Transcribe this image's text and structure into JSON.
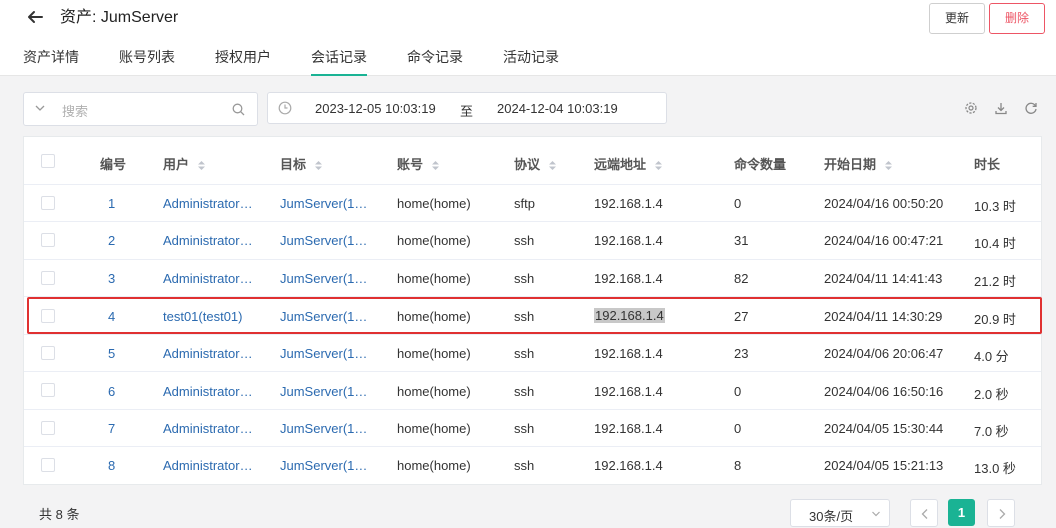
{
  "header": {
    "title": "资产: JumServer",
    "update_label": "更新",
    "delete_label": "删除"
  },
  "tabs": [
    {
      "label": "资产详情"
    },
    {
      "label": "账号列表"
    },
    {
      "label": "授权用户"
    },
    {
      "label": "会话记录",
      "active": true
    },
    {
      "label": "命令记录"
    },
    {
      "label": "活动记录"
    }
  ],
  "search": {
    "placeholder": "搜索"
  },
  "date_range": {
    "start": "2023-12-05 10:03:19",
    "separator": "至",
    "end": "2024-12-04 10:03:19"
  },
  "toolbar": {
    "icons": [
      "settings-icon",
      "download-icon",
      "refresh-icon"
    ]
  },
  "table": {
    "columns": [
      "编号",
      "用户",
      "目标",
      "账号",
      "协议",
      "远端地址",
      "命令数量",
      "开始日期",
      "时长"
    ],
    "rows": [
      {
        "id": "1",
        "user": "Administrator…",
        "target": "JumServer(1…",
        "account": "home(home)",
        "protocol": "sftp",
        "remote": "192.168.1.4",
        "commands": "0",
        "start": "2024/04/16 00:50:20",
        "duration": "10.3 时"
      },
      {
        "id": "2",
        "user": "Administrator…",
        "target": "JumServer(1…",
        "account": "home(home)",
        "protocol": "ssh",
        "remote": "192.168.1.4",
        "commands": "31",
        "start": "2024/04/16 00:47:21",
        "duration": "10.4 时"
      },
      {
        "id": "3",
        "user": "Administrator…",
        "target": "JumServer(1…",
        "account": "home(home)",
        "protocol": "ssh",
        "remote": "192.168.1.4",
        "commands": "82",
        "start": "2024/04/11 14:41:43",
        "duration": "21.2 时"
      },
      {
        "id": "4",
        "user": "test01(test01)",
        "target": "JumServer(1…",
        "account": "home(home)",
        "protocol": "ssh",
        "remote": "192.168.1.4",
        "commands": "27",
        "start": "2024/04/11 14:30:29",
        "duration": "20.9 时"
      },
      {
        "id": "5",
        "user": "Administrator…",
        "target": "JumServer(1…",
        "account": "home(home)",
        "protocol": "ssh",
        "remote": "192.168.1.4",
        "commands": "23",
        "start": "2024/04/06 20:06:47",
        "duration": "4.0 分"
      },
      {
        "id": "6",
        "user": "Administrator…",
        "target": "JumServer(1…",
        "account": "home(home)",
        "protocol": "ssh",
        "remote": "192.168.1.4",
        "commands": "0",
        "start": "2024/04/06 16:50:16",
        "duration": "2.0 秒"
      },
      {
        "id": "7",
        "user": "Administrator…",
        "target": "JumServer(1…",
        "account": "home(home)",
        "protocol": "ssh",
        "remote": "192.168.1.4",
        "commands": "0",
        "start": "2024/04/05 15:30:44",
        "duration": "7.0 秒"
      },
      {
        "id": "8",
        "user": "Administrator…",
        "target": "JumServer(1…",
        "account": "home(home)",
        "protocol": "ssh",
        "remote": "192.168.1.4",
        "commands": "8",
        "start": "2024/04/05 15:21:13",
        "duration": "13.0 秒"
      }
    ]
  },
  "pagination": {
    "total_text": "共 8 条",
    "page_size": "30条/页",
    "current_page": "1"
  },
  "colors": {
    "accent": "#1ab394",
    "danger": "#ed5565",
    "link": "#2b6ab0",
    "selection_frame": "#e03131"
  }
}
